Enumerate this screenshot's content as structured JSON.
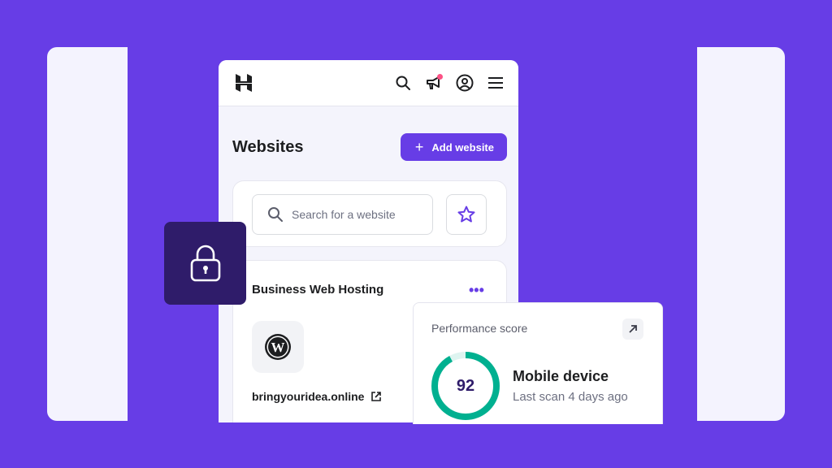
{
  "header": {
    "logo": "hostinger-logo",
    "icons": [
      "search-icon",
      "megaphone-icon",
      "account-icon",
      "menu-icon"
    ],
    "has_notification": true
  },
  "page": {
    "title": "Websites",
    "add_button_label": "Add website",
    "add_button_icon": "plus-icon"
  },
  "search": {
    "placeholder": "Search for a website",
    "value": ""
  },
  "website_card": {
    "plan": "Business Web Hosting",
    "more_icon": "more-dots-icon",
    "platform_icon": "wordpress-icon",
    "domain": "bringyouridea.online",
    "domain_link_icon": "external-link-icon"
  },
  "performance": {
    "label": "Performance score",
    "score": 92,
    "score_text": "92",
    "score_max": 100,
    "device": "Mobile device",
    "last_scan": "Last scan 4 days ago"
  },
  "colors": {
    "brand_purple": "#673de6",
    "dark_purple": "#2f1c6a",
    "score_green": "#00b090",
    "notification_pink": "#fc5185"
  }
}
